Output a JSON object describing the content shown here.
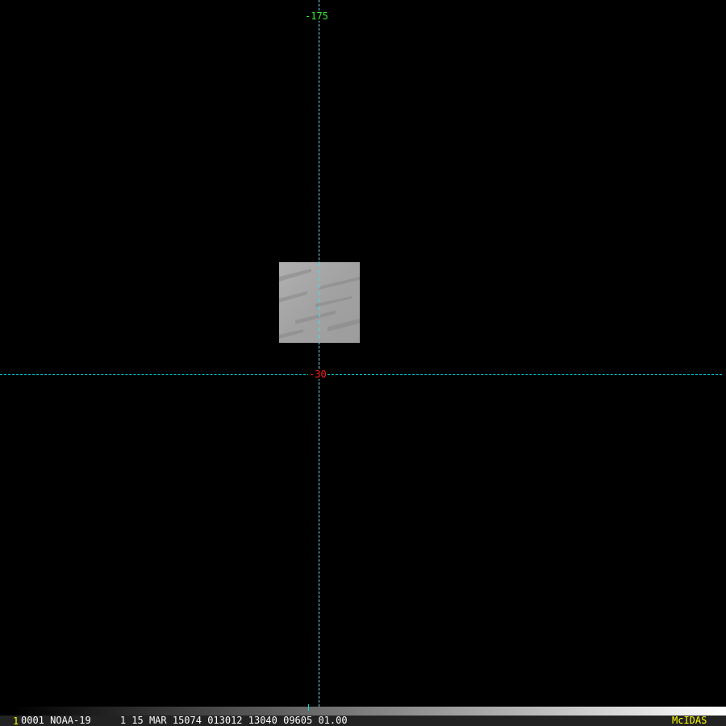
{
  "grid": {
    "longitude_label": "-175",
    "latitude_label": "-30",
    "lon_color": "#33ee33",
    "lat_color": "#ff2020",
    "line_color": "#00d8e0"
  },
  "image": {
    "description_icon": "satellite-image-tile"
  },
  "status": {
    "frame": "1",
    "info": "0001 NOAA-19     1 15 MAR 15074 013012 13040 09605 01.00",
    "brand": "McIDAS",
    "frame_color": "#ffff00",
    "brand_color": "#ffff00"
  },
  "colorbar": {
    "marker_color": "#00e0e0"
  }
}
